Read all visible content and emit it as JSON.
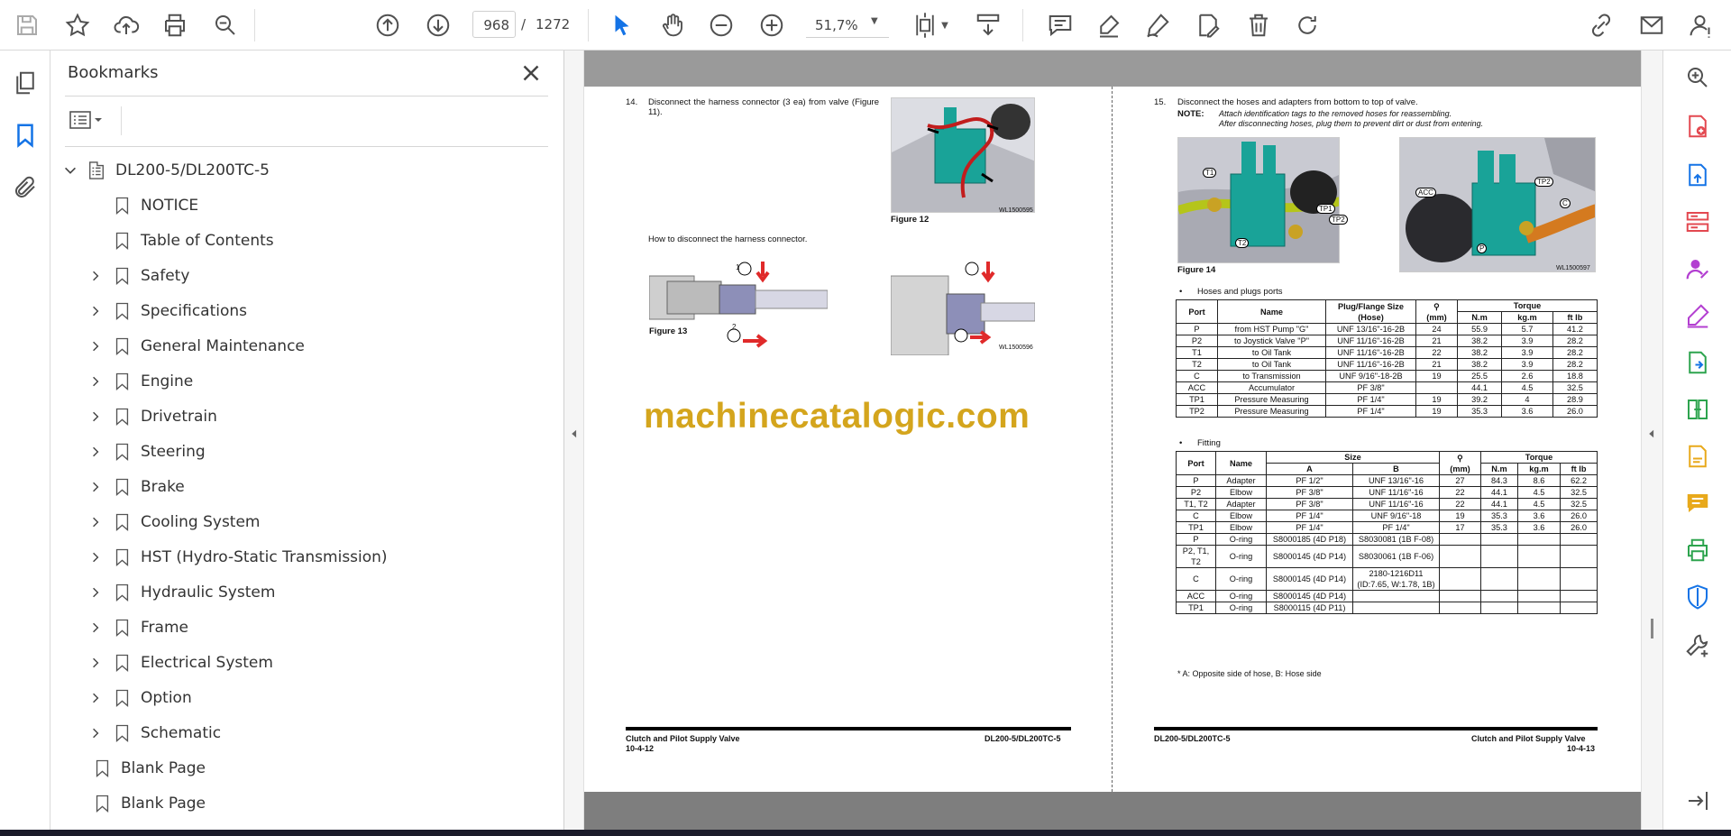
{
  "toolbar": {
    "page_current": "968",
    "page_separator": "/",
    "page_total": "1272",
    "zoom": "51,7%"
  },
  "bookmarks": {
    "title": "Bookmarks",
    "root": "DL200-5/DL200TC-5",
    "items": [
      {
        "label": "NOTICE",
        "expandable": false
      },
      {
        "label": "Table of Contents",
        "expandable": false
      },
      {
        "label": "Safety",
        "expandable": true
      },
      {
        "label": "Specifications",
        "expandable": true
      },
      {
        "label": "General Maintenance",
        "expandable": true
      },
      {
        "label": "Engine",
        "expandable": true
      },
      {
        "label": "Drivetrain",
        "expandable": true
      },
      {
        "label": "Steering",
        "expandable": true
      },
      {
        "label": "Brake",
        "expandable": true
      },
      {
        "label": "Cooling System",
        "expandable": true
      },
      {
        "label": "HST (Hydro-Static Transmission)",
        "expandable": true
      },
      {
        "label": "Hydraulic System",
        "expandable": true
      },
      {
        "label": "Frame",
        "expandable": true
      },
      {
        "label": "Electrical System",
        "expandable": true
      },
      {
        "label": "Option",
        "expandable": true
      },
      {
        "label": "Schematic",
        "expandable": true
      },
      {
        "label": "Blank Page",
        "expandable": false,
        "toplevel": true
      },
      {
        "label": "Blank Page",
        "expandable": false,
        "toplevel": true
      }
    ]
  },
  "document": {
    "left": {
      "step14_num": "14.",
      "step14_text": "Disconnect the harness connector (3 ea) from valve (Figure 11).",
      "fig12_caption": "Figure 12",
      "fig12_code": "WL1500595",
      "how_to": "How to disconnect the harness connector.",
      "fig13_caption": "Figure 13",
      "fig13_code": "WL1500596",
      "callout1": "1",
      "callout2": "2",
      "footer_left_title": "Clutch and Pilot Supply Valve",
      "footer_left_page": "10-4-12",
      "footer_right_model": "DL200-5/DL200TC-5"
    },
    "watermark": "machinecatalogic.com",
    "right": {
      "step15_num": "15.",
      "step15_text": "Disconnect the hoses and adapters from bottom to top of valve.",
      "note_label": "NOTE:",
      "note_line1": "Attach identification tags to the removed hoses for reassembling.",
      "note_line2": "After disconnecting hoses, plug them to prevent dirt or dust from entering.",
      "fig14_caption": "Figure 14",
      "fig14_code": "WL1500597",
      "labels": {
        "t1": "T1",
        "tp1": "TP1",
        "tp2": "TP2",
        "t2": "T2",
        "acc": "ACC",
        "p": "P",
        "c": "C"
      },
      "bullet1": "Hoses and plugs ports",
      "table1": {
        "headers": [
          "Port",
          "Name",
          "Plug/Flange Size (Hose)",
          "(mm)",
          "Torque",
          "N.m",
          "kg.m",
          "ft lb"
        ],
        "rows": [
          [
            "P",
            "from HST Pump \"G\"",
            "UNF 13/16\"-16-2B",
            "24",
            "55.9",
            "5.7",
            "41.2"
          ],
          [
            "P2",
            "to Joystick Valve \"P\"",
            "UNF 11/16\"-16-2B",
            "21",
            "38.2",
            "3.9",
            "28.2"
          ],
          [
            "T1",
            "to Oil Tank",
            "UNF 11/16\"-16-2B",
            "22",
            "38.2",
            "3.9",
            "28.2"
          ],
          [
            "T2",
            "to Oil Tank",
            "UNF 11/16\"-16-2B",
            "21",
            "38.2",
            "3.9",
            "28.2"
          ],
          [
            "C",
            "to Transmission",
            "UNF 9/16\"-18-2B",
            "19",
            "25.5",
            "2.6",
            "18.8"
          ],
          [
            "ACC",
            "Accumulator",
            "PF 3/8\"",
            "",
            "44.1",
            "4.5",
            "32.5"
          ],
          [
            "TP1",
            "Pressure Measuring",
            "PF 1/4\"",
            "19",
            "39.2",
            "4",
            "28.9"
          ],
          [
            "TP2",
            "Pressure Measuring",
            "PF 1/4\"",
            "19",
            "35.3",
            "3.6",
            "26.0"
          ]
        ]
      },
      "bullet2": "Fitting",
      "table2": {
        "headers": [
          "Port",
          "Name",
          "Size",
          "A",
          "B",
          "(mm)",
          "Torque",
          "N.m",
          "kg.m",
          "ft lb"
        ],
        "rows": [
          [
            "P",
            "Adapter",
            "PF 1/2\"",
            "UNF 13/16\"-16",
            "27",
            "84.3",
            "8.6",
            "62.2"
          ],
          [
            "P2",
            "Elbow",
            "PF 3/8\"",
            "UNF 11/16\"-16",
            "22",
            "44.1",
            "4.5",
            "32.5"
          ],
          [
            "T1, T2",
            "Adapter",
            "PF 3/8\"",
            "UNF 11/16\"-16",
            "22",
            "44.1",
            "4.5",
            "32.5"
          ],
          [
            "C",
            "Elbow",
            "PF 1/4\"",
            "UNF 9/16\"-18",
            "19",
            "35.3",
            "3.6",
            "26.0"
          ],
          [
            "TP1",
            "Elbow",
            "PF 1/4\"",
            "PF 1/4\"",
            "17",
            "35.3",
            "3.6",
            "26.0"
          ],
          [
            "P",
            "O-ring",
            "S8000185 (4D P18)",
            "S8030081 (1B F-08)",
            "",
            "",
            "",
            ""
          ],
          [
            "P2, T1, T2",
            "O-ring",
            "S8000145 (4D P14)",
            "S8030061 (1B F-06)",
            "",
            "",
            "",
            ""
          ],
          [
            "C",
            "O-ring",
            "S8000145 (4D P14)",
            "2180-1216D11 (ID:7.65, W:1.78, 1B)",
            "",
            "",
            "",
            ""
          ],
          [
            "ACC",
            "O-ring",
            "S8000145 (4D P14)",
            "",
            "",
            "",
            "",
            ""
          ],
          [
            "TP1",
            "O-ring",
            "S8000115 (4D P11)",
            "",
            "",
            "",
            "",
            ""
          ]
        ]
      },
      "footnote": "* A: Opposite side of hose, B: Hose side",
      "footer_left_model": "DL200-5/DL200TC-5",
      "footer_right_title": "Clutch and Pilot Supply Valve",
      "footer_right_page": "10-4-13"
    }
  },
  "colors": {
    "accent": "#1473e6",
    "icon_gray": "#505050",
    "doc_bg": "#7e7e7e",
    "watermark": "#d4a51d",
    "purple_icon": "#b33fd1",
    "red_icon": "#e34850",
    "green_icon": "#2da44e",
    "yellow_icon": "#e8a91b"
  }
}
